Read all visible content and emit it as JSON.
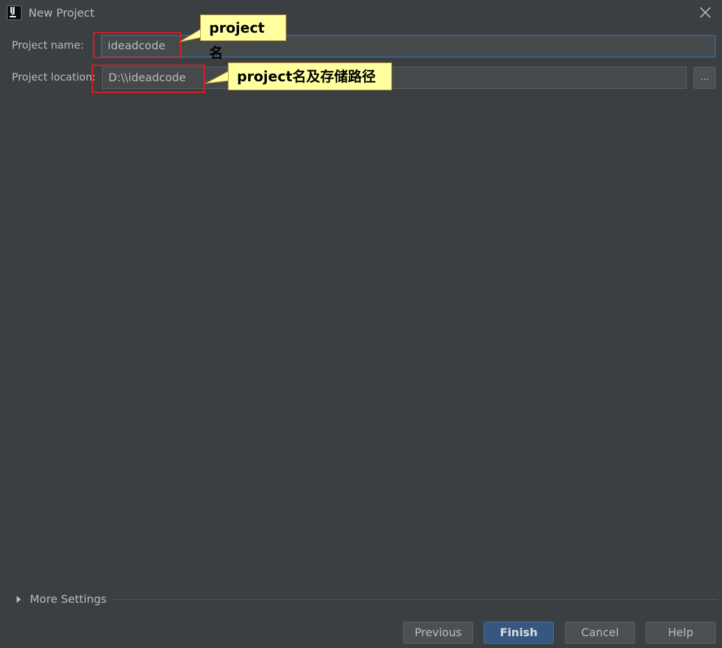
{
  "window": {
    "title": "New Project",
    "icon": "intellij-idea-icon",
    "icon_text": "IJ"
  },
  "form": {
    "project_name_label": "Project name:",
    "project_name_value": "ideadcode",
    "project_location_label": "Project location:",
    "project_location_value": "D:\\\\ideadcode",
    "browse_label": "..."
  },
  "annotations": {
    "callout_name": "project名",
    "callout_location": "project名及存储路径"
  },
  "more_settings": {
    "label": "More Settings",
    "expanded": false
  },
  "buttons": {
    "previous": "Previous",
    "finish": "Finish",
    "cancel": "Cancel",
    "help": "Help"
  },
  "colors": {
    "background": "#3c3f41",
    "primary_button": "#365880",
    "focus_border": "#3d6185",
    "annotation_red": "#d0202a",
    "annotation_yellow": "#ffffa0"
  }
}
